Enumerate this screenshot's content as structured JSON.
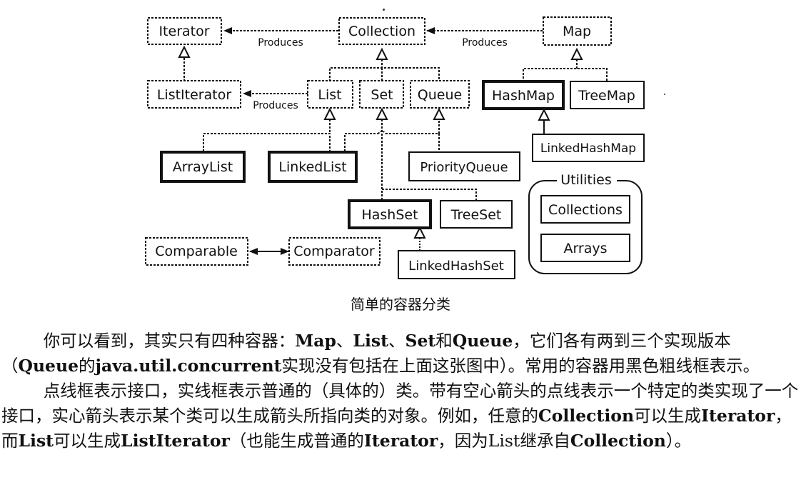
{
  "figure": {
    "nodes": {
      "iterator": {
        "label": "Iterator",
        "kind": "interface"
      },
      "collection": {
        "label": "Collection",
        "kind": "interface"
      },
      "map": {
        "label": "Map",
        "kind": "interface"
      },
      "list_iterator": {
        "label": "ListIterator",
        "kind": "interface"
      },
      "list": {
        "label": "List",
        "kind": "interface"
      },
      "set": {
        "label": "Set",
        "kind": "interface"
      },
      "queue": {
        "label": "Queue",
        "kind": "interface"
      },
      "hash_map": {
        "label": "HashMap",
        "kind": "common-class"
      },
      "tree_map": {
        "label": "TreeMap",
        "kind": "class"
      },
      "linked_hash_map": {
        "label": "LinkedHashMap",
        "kind": "class"
      },
      "array_list": {
        "label": "ArrayList",
        "kind": "common-class"
      },
      "linked_list": {
        "label": "LinkedList",
        "kind": "common-class"
      },
      "priority_queue": {
        "label": "PriorityQueue",
        "kind": "class"
      },
      "hash_set": {
        "label": "HashSet",
        "kind": "common-class"
      },
      "tree_set": {
        "label": "TreeSet",
        "kind": "class"
      },
      "linked_hash_set": {
        "label": "LinkedHashSet",
        "kind": "class"
      },
      "comparable": {
        "label": "Comparable",
        "kind": "interface"
      },
      "comparator": {
        "label": "Comparator",
        "kind": "interface"
      },
      "collections": {
        "label": "Collections",
        "kind": "class"
      },
      "arrays": {
        "label": "Arrays",
        "kind": "class"
      }
    },
    "edge_labels": {
      "collection_produces_iterator": "Produces",
      "map_produces_collection": "Produces",
      "list_produces_list_iterator": "Produces"
    },
    "utilities_group_label": "Utilities",
    "caption": "简单的容器分类"
  },
  "paragraphs": [
    [
      {
        "t": "你可以看到，其实只有四种容器："
      },
      {
        "t": "Map",
        "b": true
      },
      {
        "t": "、"
      },
      {
        "t": "List",
        "b": true
      },
      {
        "t": "、"
      },
      {
        "t": "Set",
        "b": true
      },
      {
        "t": "和"
      },
      {
        "t": "Queue",
        "b": true
      },
      {
        "t": "，它们各有两到三个实现版本（"
      },
      {
        "t": "Queue",
        "b": true
      },
      {
        "t": "的"
      },
      {
        "t": "java.util.concurrent",
        "b": true
      },
      {
        "t": "实现没有包括在上面这张图中）。常用的容器用黑色粗线框表示。"
      }
    ],
    [
      {
        "t": "点线框表示接口，实线框表示普通的（具体的）类。带有空心箭头的点线表示一个特定的类实现了一个接口，实心箭头表示某个类可以生成箭头所指向类的对象。例如，任意的"
      },
      {
        "t": "Collection",
        "b": true
      },
      {
        "t": "可以生成"
      },
      {
        "t": "Iterator",
        "b": true
      },
      {
        "t": "，而"
      },
      {
        "t": "List",
        "b": true
      },
      {
        "t": "可以生成"
      },
      {
        "t": "ListIterator",
        "b": true
      },
      {
        "t": "（也能生成普通的"
      },
      {
        "t": "Iterator",
        "b": true
      },
      {
        "t": "，因为List继承自"
      },
      {
        "t": "Collection",
        "b": true
      },
      {
        "t": "）。"
      }
    ]
  ]
}
